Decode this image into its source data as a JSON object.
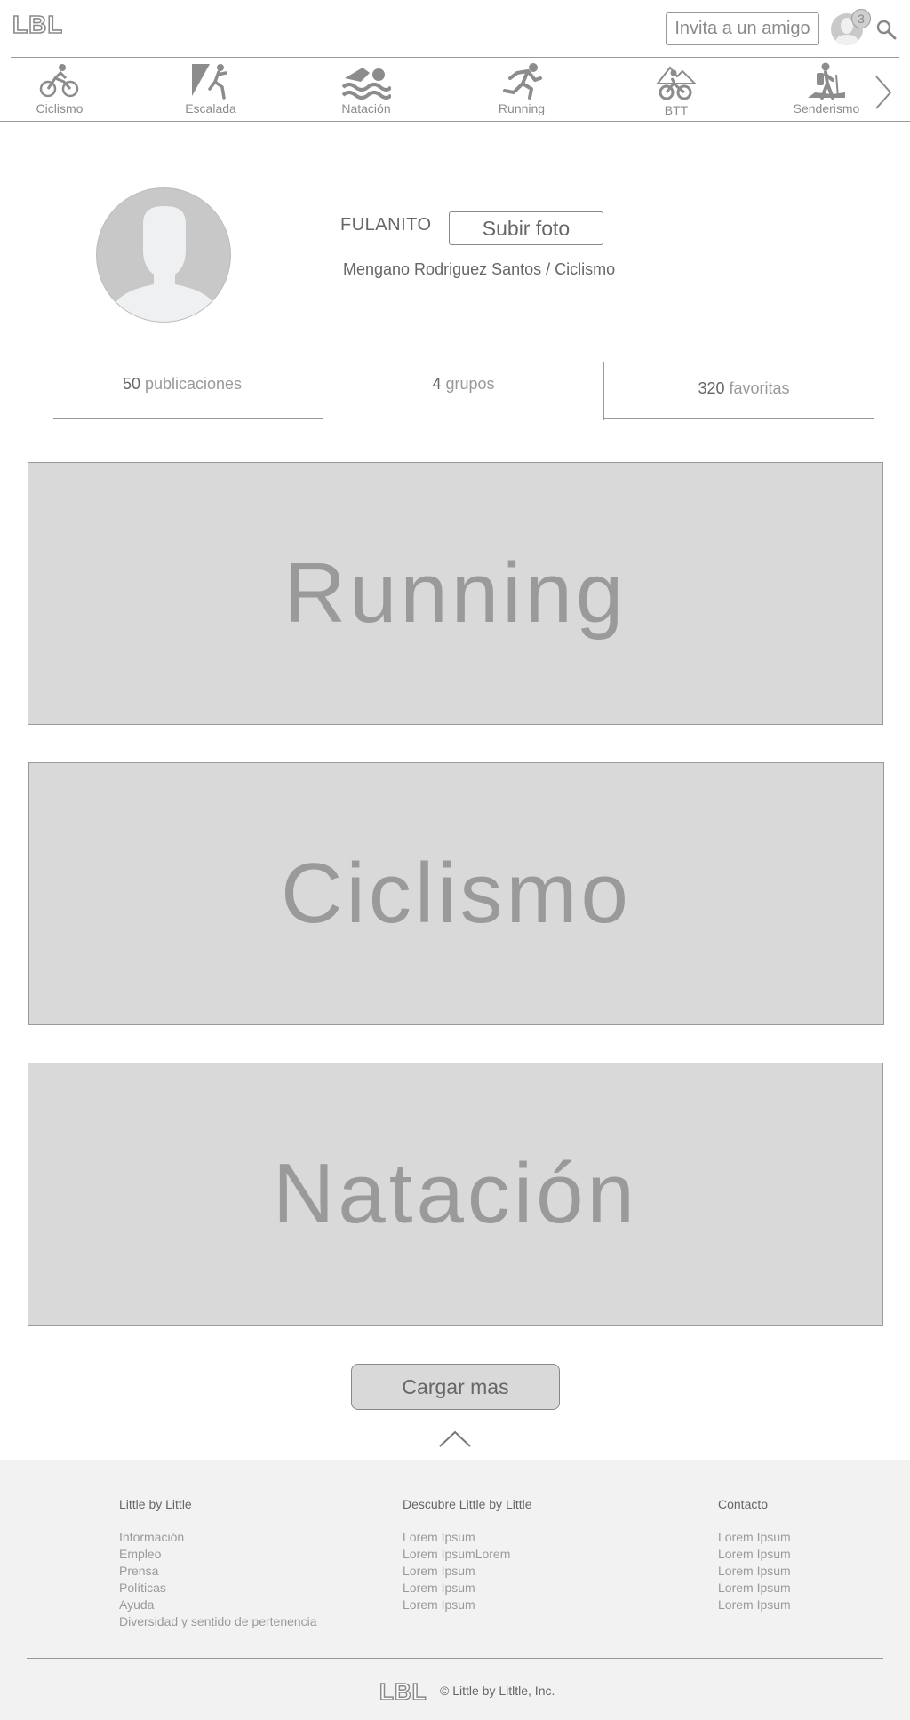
{
  "header": {
    "logo_text": "LBL",
    "invite_label": "Invita a un amigo",
    "notification_count": "3"
  },
  "sports_nav": [
    {
      "label": "Ciclismo",
      "icon": "bicycle-icon"
    },
    {
      "label": "Escalada",
      "icon": "climbing-icon"
    },
    {
      "label": "Natación",
      "icon": "swimming-icon"
    },
    {
      "label": "Running",
      "icon": "running-icon"
    },
    {
      "label": "BTT",
      "icon": "mountain-bike-icon"
    },
    {
      "label": "Senderismo",
      "icon": "hiking-icon"
    }
  ],
  "profile": {
    "username": "FULANITO",
    "upload_label": "Subir foto",
    "fullname": "Mengano Rodriguez Santos / Ciclismo"
  },
  "tabs": [
    {
      "count": "50",
      "label": "publicaciones"
    },
    {
      "count": "4",
      "label": "grupos"
    },
    {
      "count": "320",
      "label": "favoritas"
    }
  ],
  "groups": [
    {
      "label": "Running"
    },
    {
      "label": "Ciclismo"
    },
    {
      "label": "Natación"
    }
  ],
  "load_more_label": "Cargar mas",
  "footer": {
    "columns": [
      {
        "title": "Little by Little",
        "items": [
          "Información",
          "Empleo",
          "Prensa",
          "Políticas",
          "Ayuda",
          "Diversidad y sentido de pertenencia"
        ]
      },
      {
        "title": "Descubre Little by Little",
        "items": [
          "Lorem Ipsum",
          "Lorem IpsumLorem",
          "Lorem Ipsum",
          "Lorem Ipsum",
          "Lorem Ipsum"
        ]
      },
      {
        "title": "Contacto",
        "items": [
          "Lorem Ipsum",
          "Lorem Ipsum",
          "Lorem Ipsum",
          "Lorem Ipsum",
          "Lorem Ipsum"
        ]
      }
    ],
    "logo_text": "LBL",
    "copyright": "© Little by Litltle, Inc."
  },
  "colors": {
    "card_bg": "#d9d9d9",
    "footer_bg": "#f2f2f2",
    "icon_gray": "#8c8c8c"
  }
}
